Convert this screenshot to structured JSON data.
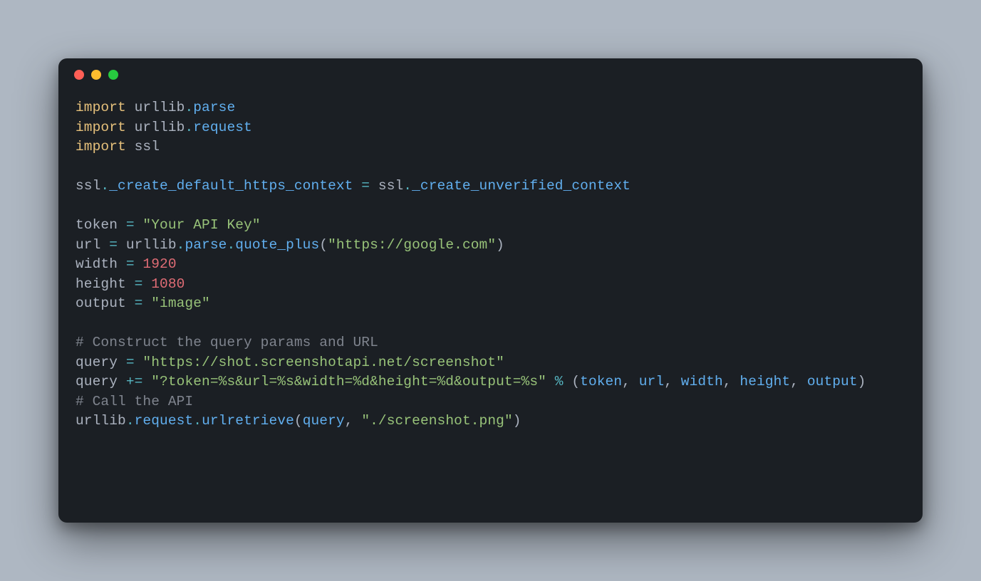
{
  "window": {
    "traffic_lights": [
      "red",
      "yellow",
      "green"
    ]
  },
  "code": {
    "kw_import": "import",
    "sp": " ",
    "urllib": "urllib",
    "dot": ".",
    "parse": "parse",
    "request": "request",
    "ssl": "ssl",
    "ssl_lhs_attr": "_create_default_https_context",
    "eq": " = ",
    "ssl_rhs_attr": "_create_unverified_context",
    "token_var": "token",
    "token_str": "\"Your API Key\"",
    "url_var": "url",
    "quote_plus": "quote_plus",
    "lpar": "(",
    "rpar": ")",
    "url_arg": "\"https://google.com\"",
    "width_var": "width",
    "width_val": "1920",
    "height_var": "height",
    "height_val": "1080",
    "output_var": "output",
    "output_str": "\"image\"",
    "cmt1": "# Construct the query params and URL",
    "query_var": "query",
    "query_url": "\"https://shot.screenshotapi.net/screenshot\"",
    "plus_eq": " += ",
    "fmt_str": "\"?token=%s&url=%s&width=%d&height=%d&output=%s\"",
    "pct": " % ",
    "tuple_open": "(",
    "comma": ", ",
    "tuple_close": ")",
    "cmt2": "# Call the API",
    "urlretrieve": "urlretrieve",
    "out_file": "\"./screenshot.png\""
  }
}
